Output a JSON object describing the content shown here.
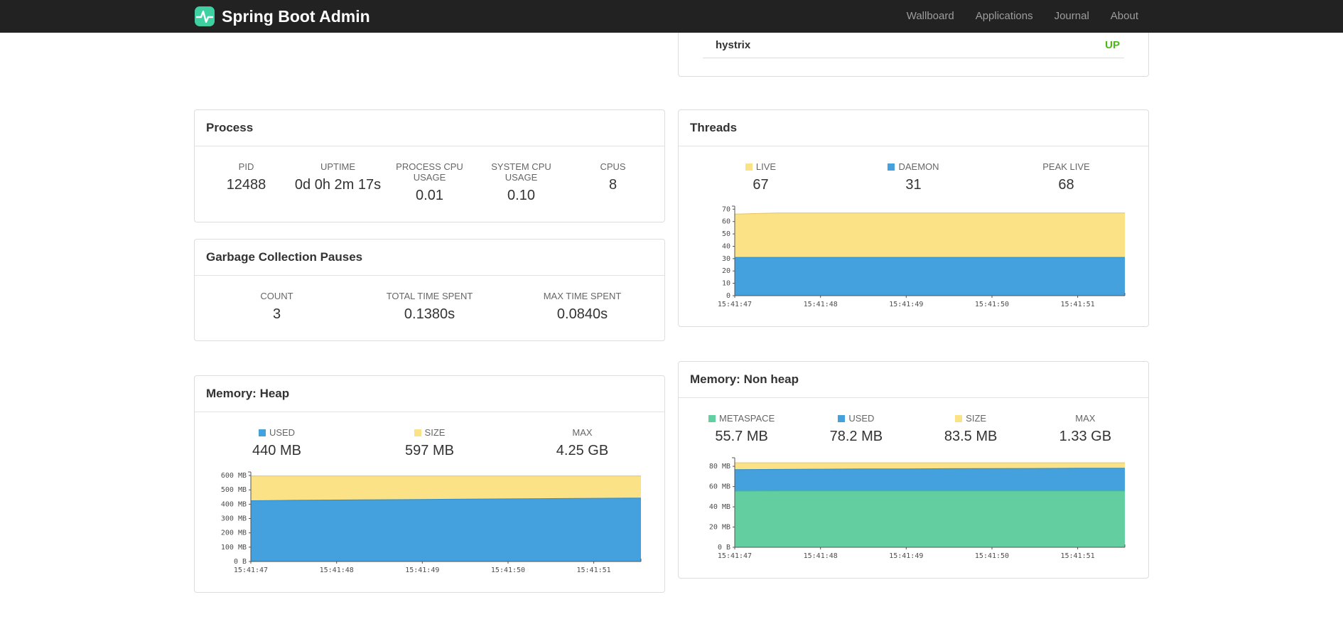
{
  "navbar": {
    "brand": "Spring Boot Admin",
    "brand_icon_color": "#3ed0a0",
    "links": [
      {
        "label": "Wallboard"
      },
      {
        "label": "Applications"
      },
      {
        "label": "Journal"
      },
      {
        "label": "About"
      }
    ]
  },
  "services_panel": {
    "service": "hystrix",
    "status": "UP",
    "status_color": "#4ab814"
  },
  "process": {
    "title": "Process",
    "stats": [
      {
        "label": "PID",
        "value": "12488"
      },
      {
        "label": "UPTIME",
        "value": "0d 0h 2m 17s"
      },
      {
        "label": "PROCESS CPU USAGE",
        "value": "0.01"
      },
      {
        "label": "SYSTEM CPU USAGE",
        "value": "0.10"
      },
      {
        "label": "CPUS",
        "value": "8"
      }
    ]
  },
  "gc": {
    "title": "Garbage Collection Pauses",
    "stats": [
      {
        "label": "COUNT",
        "value": "3"
      },
      {
        "label": "TOTAL TIME SPENT",
        "value": "0.1380s"
      },
      {
        "label": "MAX TIME SPENT",
        "value": "0.0840s"
      }
    ]
  },
  "threads": {
    "title": "Threads",
    "legend": [
      {
        "label": "LIVE",
        "value": "67",
        "color": "#fbe287"
      },
      {
        "label": "DAEMON",
        "value": "31",
        "color": "#45a1dd"
      },
      {
        "label": "PEAK LIVE",
        "value": "68"
      }
    ]
  },
  "heap": {
    "title": "Memory: Heap",
    "legend": [
      {
        "label": "USED",
        "value": "440 MB",
        "color": "#45a1dd"
      },
      {
        "label": "SIZE",
        "value": "597 MB",
        "color": "#fbe287"
      },
      {
        "label": "MAX",
        "value": "4.25 GB"
      }
    ]
  },
  "nonheap": {
    "title": "Memory: Non heap",
    "legend": [
      {
        "label": "METASPACE",
        "value": "55.7 MB",
        "color": "#63cfa0"
      },
      {
        "label": "USED",
        "value": "78.2 MB",
        "color": "#45a1dd"
      },
      {
        "label": "SIZE",
        "value": "83.5 MB",
        "color": "#fbe287"
      },
      {
        "label": "MAX",
        "value": "1.33 GB"
      }
    ]
  },
  "chart_data": [
    {
      "id": "threads",
      "type": "area",
      "title": "Threads",
      "xlabel": "",
      "ylabel": "",
      "x": [
        0,
        0.5,
        1,
        1.5,
        2,
        2.5,
        3,
        3.5,
        4,
        4.55
      ],
      "x_domain": [
        0,
        4.55
      ],
      "x_tick_values": [
        0,
        1,
        2,
        3,
        4
      ],
      "x_tick_labels": [
        "15:41:47",
        "15:41:48",
        "15:41:49",
        "15:41:50",
        "15:41:51"
      ],
      "y_max": 72.5,
      "y_tick_values": [
        0,
        10,
        20,
        30,
        40,
        50,
        60,
        70
      ],
      "y_tick_labels": [
        "0",
        "10",
        "20",
        "30",
        "40",
        "50",
        "60",
        "70"
      ],
      "series": [
        {
          "name": "LIVE",
          "color": "#fbe287",
          "stroke": "#e3c45f",
          "values": [
            66,
            67,
            67,
            67,
            67,
            67,
            67,
            67,
            67,
            67
          ]
        },
        {
          "name": "DAEMON",
          "color": "#45a1dd",
          "stroke": "#2f8cc9",
          "values": [
            31,
            31,
            31,
            31,
            31,
            31,
            31,
            31,
            31,
            31
          ]
        }
      ]
    },
    {
      "id": "heap",
      "type": "area",
      "title": "Memory: Heap",
      "xlabel": "",
      "ylabel": "",
      "x": [
        0,
        0.5,
        1,
        1.5,
        2,
        2.5,
        3,
        3.5,
        4,
        4.55
      ],
      "x_domain": [
        0,
        4.55
      ],
      "x_tick_values": [
        0,
        1,
        2,
        3,
        4
      ],
      "x_tick_labels": [
        "15:41:47",
        "15:41:48",
        "15:41:49",
        "15:41:50",
        "15:41:51"
      ],
      "y_max": 625,
      "y_tick_values": [
        0,
        100,
        200,
        300,
        400,
        500,
        600
      ],
      "y_tick_labels": [
        "0 B",
        "100 MB",
        "200 MB",
        "300 MB",
        "400 MB",
        "500 MB",
        "600 MB"
      ],
      "series": [
        {
          "name": "SIZE",
          "color": "#fbe287",
          "stroke": "#e3c45f",
          "values": [
            597,
            597,
            597,
            597,
            597,
            597,
            597,
            597,
            597,
            597
          ]
        },
        {
          "name": "USED",
          "color": "#45a1dd",
          "stroke": "#2f8cc9",
          "values": [
            424,
            427,
            429,
            431,
            433,
            435,
            437,
            439,
            441,
            443
          ]
        }
      ]
    },
    {
      "id": "nonheap",
      "type": "area",
      "title": "Memory: Non heap",
      "xlabel": "",
      "ylabel": "",
      "x": [
        0,
        0.5,
        1,
        1.5,
        2,
        2.5,
        3,
        3.5,
        4,
        4.55
      ],
      "x_domain": [
        0,
        4.55
      ],
      "x_tick_values": [
        0,
        1,
        2,
        3,
        4
      ],
      "x_tick_labels": [
        "15:41:47",
        "15:41:48",
        "15:41:49",
        "15:41:50",
        "15:41:51"
      ],
      "y_max": 88.5,
      "y_tick_values": [
        0,
        20,
        40,
        60,
        80
      ],
      "y_tick_labels": [
        "0 B",
        "20 MB",
        "40 MB",
        "60 MB",
        "80 MB"
      ],
      "series": [
        {
          "name": "SIZE",
          "color": "#fbe287",
          "stroke": "#e3c45f",
          "values": [
            83.5,
            83.5,
            83.5,
            83.5,
            83.5,
            83.5,
            83.5,
            83.5,
            83.5,
            83.5
          ]
        },
        {
          "name": "USED",
          "color": "#45a1dd",
          "stroke": "#2f8cc9",
          "values": [
            76.8,
            77.0,
            77.2,
            77.4,
            77.5,
            77.7,
            77.8,
            77.9,
            78.1,
            78.2
          ]
        },
        {
          "name": "METASPACE",
          "color": "#63cfa0",
          "stroke": "#46bd8b",
          "values": [
            55.5,
            55.6,
            55.6,
            55.7,
            55.7,
            55.7,
            55.7,
            55.7,
            55.7,
            55.7
          ]
        }
      ]
    }
  ]
}
